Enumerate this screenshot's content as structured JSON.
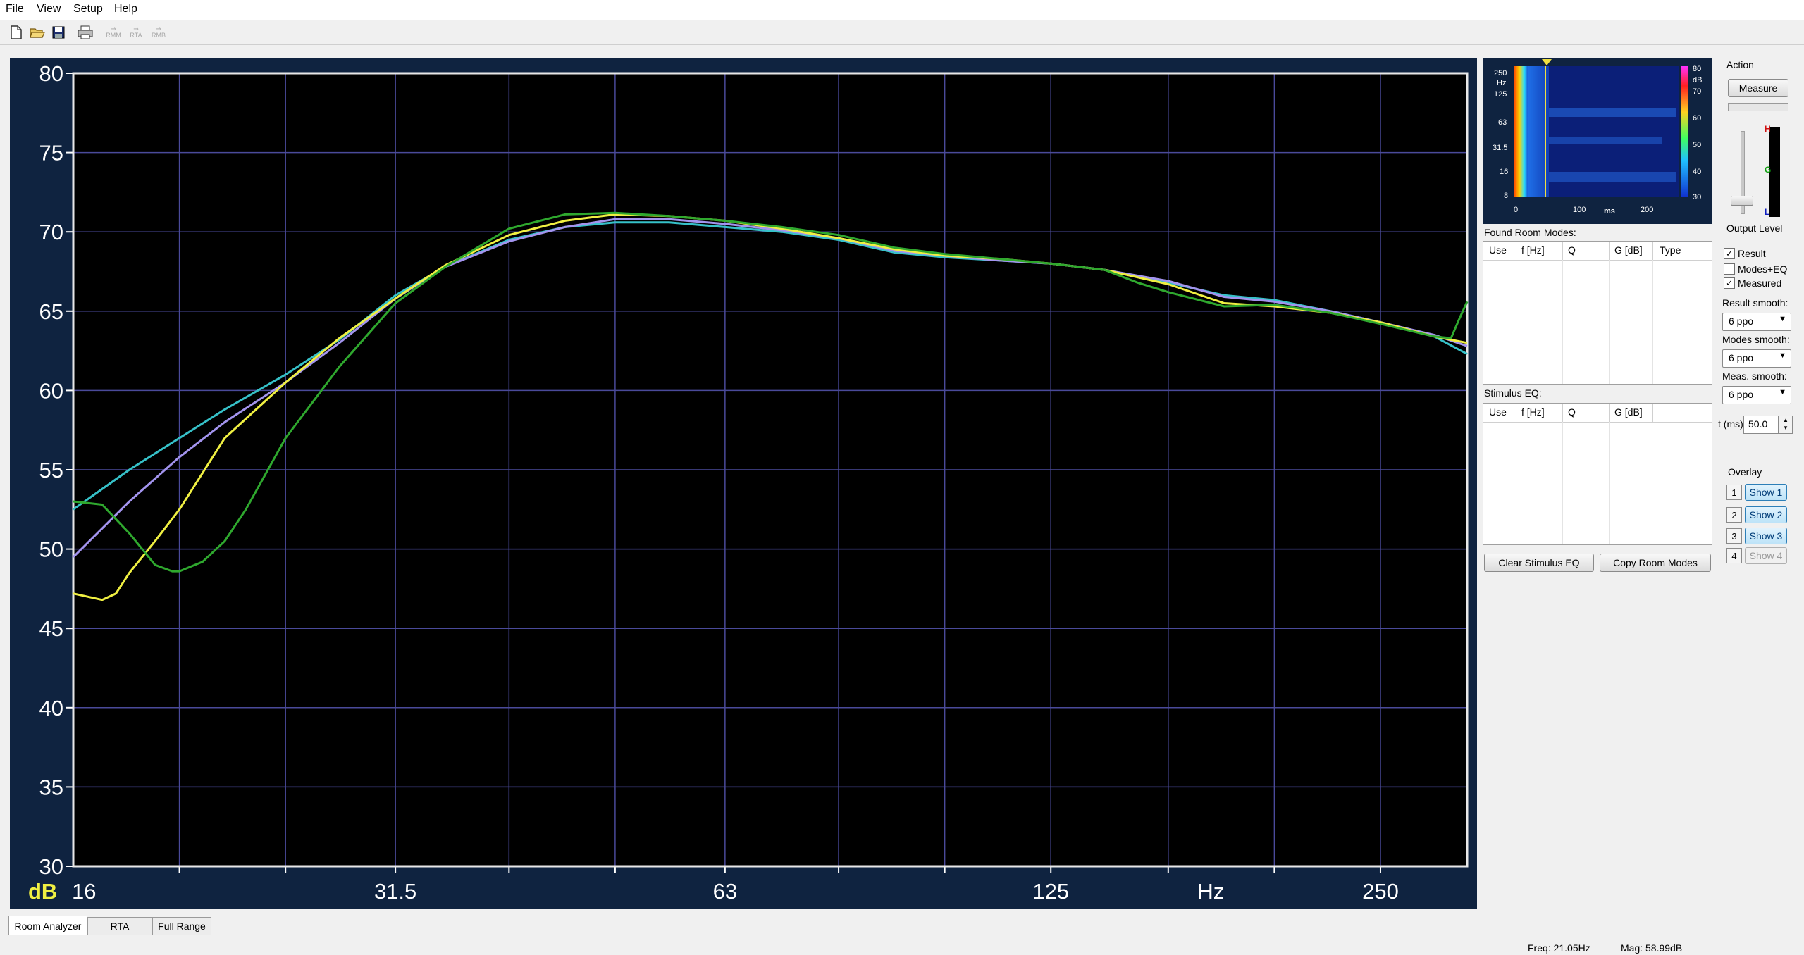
{
  "menu": {
    "file": "File",
    "view": "View",
    "setup": "Setup",
    "help": "Help"
  },
  "toolbar": {
    "rmm": "RMM",
    "rta": "RTA",
    "rmb": "RMB"
  },
  "colors": {
    "background": "#f0f0f0",
    "plot_bg": "#000000",
    "plot_frame": "#0f2340",
    "grid": "#4a4a9a",
    "accent": "#2d7fb8"
  },
  "icons": [
    "new-file-icon",
    "open-folder-icon",
    "save-disk-icon",
    "print-icon",
    "arrow-rmm-icon",
    "arrow-rta-icon",
    "arrow-rmb-icon"
  ],
  "chart_data": {
    "type": "line",
    "x_scale": "log",
    "xlim": [
      16,
      300
    ],
    "ylim": [
      30,
      80
    ],
    "ylabel": "dB",
    "xlabel": "Hz",
    "y_ticks": [
      "80",
      "75",
      "70",
      "65",
      "60",
      "55",
      "50",
      "45",
      "40",
      "35",
      "30"
    ],
    "x_tick_labels": [
      {
        "value": 16,
        "label": "16"
      },
      {
        "value": 31.5,
        "label": "31.5"
      },
      {
        "value": 63,
        "label": "63"
      },
      {
        "value": 125,
        "label": "125"
      },
      {
        "value": 175,
        "label": "Hz"
      },
      {
        "value": 250,
        "label": "250"
      }
    ],
    "x_grid": [
      20,
      25,
      31.5,
      40,
      50,
      63,
      80,
      100,
      125,
      160,
      200,
      250
    ],
    "series": [
      {
        "color": "#36c1c8",
        "points": [
          [
            16,
            52.5
          ],
          [
            18,
            55
          ],
          [
            20,
            57
          ],
          [
            22,
            58.8
          ],
          [
            25,
            61
          ],
          [
            28,
            63.2
          ],
          [
            31.5,
            66
          ],
          [
            35,
            67.8
          ],
          [
            40,
            69.5
          ],
          [
            45,
            70.3
          ],
          [
            50,
            70.6
          ],
          [
            56,
            70.6
          ],
          [
            63,
            70.3
          ],
          [
            71,
            70
          ],
          [
            80,
            69.5
          ],
          [
            90,
            68.7
          ],
          [
            100,
            68.4
          ],
          [
            112,
            68.2
          ],
          [
            125,
            68
          ],
          [
            140,
            67.6
          ],
          [
            160,
            66.8
          ],
          [
            180,
            66
          ],
          [
            200,
            65.7
          ],
          [
            225,
            65
          ],
          [
            250,
            64.3
          ],
          [
            280,
            63.4
          ],
          [
            300,
            62.3
          ]
        ]
      },
      {
        "color": "#a394ee",
        "points": [
          [
            16,
            49.5
          ],
          [
            18,
            53
          ],
          [
            20,
            55.8
          ],
          [
            22,
            58
          ],
          [
            25,
            60.5
          ],
          [
            28,
            63
          ],
          [
            31.5,
            65.8
          ],
          [
            35,
            67.8
          ],
          [
            40,
            69.4
          ],
          [
            45,
            70.3
          ],
          [
            50,
            70.8
          ],
          [
            56,
            70.8
          ],
          [
            63,
            70.5
          ],
          [
            71,
            70.1
          ],
          [
            80,
            69.6
          ],
          [
            90,
            68.8
          ],
          [
            100,
            68.5
          ],
          [
            112,
            68.2
          ],
          [
            125,
            68
          ],
          [
            140,
            67.6
          ],
          [
            160,
            66.9
          ],
          [
            180,
            65.9
          ],
          [
            200,
            65.6
          ],
          [
            225,
            65
          ],
          [
            250,
            64.3
          ],
          [
            280,
            63.5
          ],
          [
            300,
            62.8
          ]
        ]
      },
      {
        "color": "#f0f042",
        "points": [
          [
            16,
            47.2
          ],
          [
            17,
            46.8
          ],
          [
            17.5,
            47.2
          ],
          [
            18,
            48.5
          ],
          [
            19,
            50.5
          ],
          [
            20,
            52.5
          ],
          [
            22,
            57
          ],
          [
            25,
            60.5
          ],
          [
            28,
            63.3
          ],
          [
            31.5,
            65.8
          ],
          [
            35,
            67.9
          ],
          [
            40,
            69.8
          ],
          [
            45,
            70.7
          ],
          [
            50,
            71.1
          ],
          [
            56,
            71
          ],
          [
            63,
            70.7
          ],
          [
            71,
            70.2
          ],
          [
            80,
            69.6
          ],
          [
            90,
            68.9
          ],
          [
            100,
            68.5
          ],
          [
            112,
            68.3
          ],
          [
            125,
            68
          ],
          [
            140,
            67.6
          ],
          [
            160,
            66.7
          ],
          [
            180,
            65.5
          ],
          [
            200,
            65.3
          ],
          [
            225,
            64.9
          ],
          [
            250,
            64.3
          ],
          [
            280,
            63.4
          ],
          [
            300,
            63
          ]
        ]
      },
      {
        "color": "#2fa82e",
        "points": [
          [
            16,
            53
          ],
          [
            17,
            52.8
          ],
          [
            18,
            51
          ],
          [
            19,
            49
          ],
          [
            19.7,
            48.6
          ],
          [
            20,
            48.6
          ],
          [
            21,
            49.2
          ],
          [
            22,
            50.5
          ],
          [
            23,
            52.5
          ],
          [
            25,
            57
          ],
          [
            28,
            61.5
          ],
          [
            31.5,
            65.5
          ],
          [
            35,
            67.8
          ],
          [
            40,
            70.2
          ],
          [
            45,
            71.1
          ],
          [
            50,
            71.2
          ],
          [
            56,
            71
          ],
          [
            63,
            70.7
          ],
          [
            71,
            70.3
          ],
          [
            80,
            69.8
          ],
          [
            90,
            69
          ],
          [
            100,
            68.6
          ],
          [
            112,
            68.3
          ],
          [
            125,
            68
          ],
          [
            140,
            67.6
          ],
          [
            150,
            66.8
          ],
          [
            160,
            66.2
          ],
          [
            180,
            65.3
          ],
          [
            200,
            65.4
          ],
          [
            225,
            64.9
          ],
          [
            250,
            64.2
          ],
          [
            280,
            63.4
          ],
          [
            290,
            63.3
          ],
          [
            295,
            64.5
          ],
          [
            300,
            65.6
          ]
        ]
      }
    ]
  },
  "panel": {
    "spectrogram": {
      "y_labels": [
        "250",
        "Hz",
        "125",
        "63",
        "31.5",
        "16",
        "8"
      ],
      "x_labels": [
        "0",
        "100",
        "ms",
        "200"
      ],
      "scale_labels": [
        "80",
        "dB",
        "70",
        "60",
        "50",
        "40",
        "30"
      ]
    },
    "found_modes_label": "Found Room Modes:",
    "found_modes_cols": [
      "Use",
      "f [Hz]",
      "Q",
      "G [dB]",
      "Type"
    ],
    "stimulus_label": "Stimulus EQ:",
    "stimulus_cols": [
      "Use",
      "f [Hz]",
      "Q",
      "G [dB]"
    ],
    "clear_button": "Clear Stimulus EQ",
    "copy_button": "Copy Room Modes",
    "action_label": "Action",
    "measure_button": "Measure",
    "output_level_label": "Output Level",
    "meter_h": "H",
    "meter_g": "G",
    "meter_l": "L",
    "checks": [
      {
        "label": "Result",
        "checked": "✓"
      },
      {
        "label": "Modes+EQ",
        "checked": ""
      },
      {
        "label": "Measured",
        "checked": "✓"
      }
    ],
    "result_smooth_label": "Result smooth:",
    "result_smooth_value": "6 ppo",
    "modes_smooth_label": "Modes smooth:",
    "modes_smooth_value": "6 ppo",
    "meas_smooth_label": "Meas. smooth:",
    "meas_smooth_value": "6 ppo",
    "t_label": "t (ms)",
    "t_value": "50.0",
    "overlay_label": "Overlay",
    "overlay": [
      {
        "num": "1",
        "label": "Show 1"
      },
      {
        "num": "2",
        "label": "Show 2"
      },
      {
        "num": "3",
        "label": "Show 3"
      },
      {
        "num": "4",
        "label": "Show 4"
      }
    ]
  },
  "tabs": [
    "Room Analyzer",
    "RTA",
    "Full Range"
  ],
  "status": {
    "freq": "Freq: 21.05Hz",
    "mag": "Mag: 58.99dB"
  }
}
